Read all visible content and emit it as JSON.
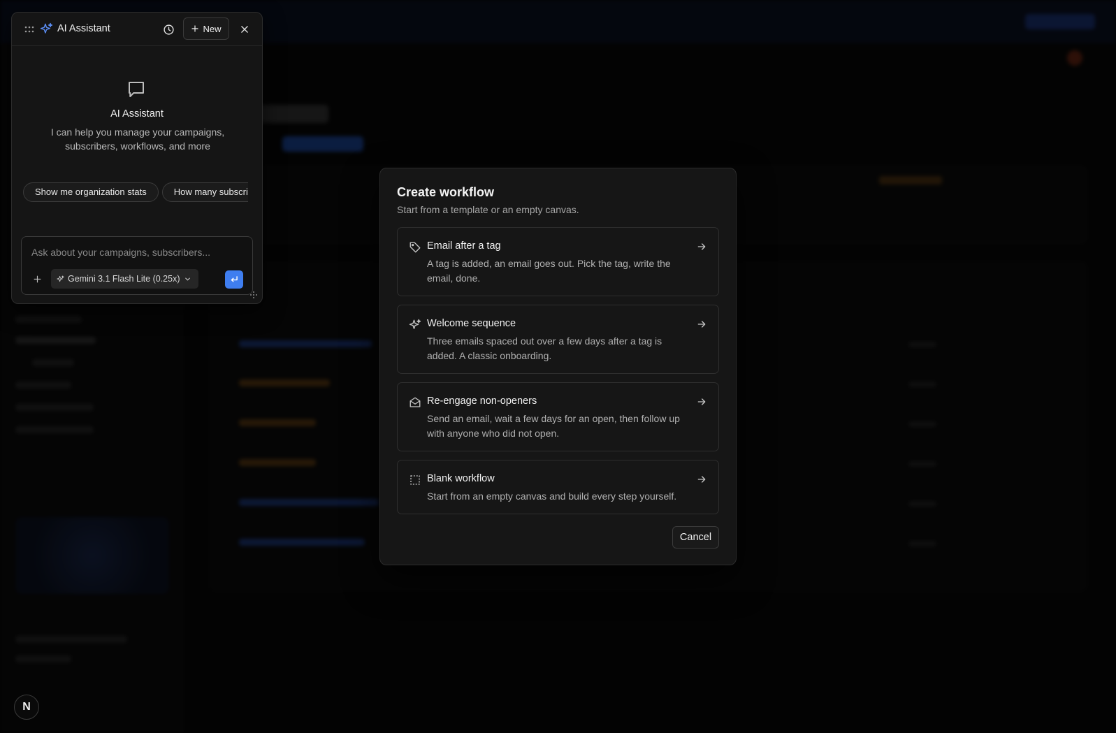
{
  "assistant": {
    "title": "AI Assistant",
    "new_label": "New",
    "empty_title": "AI Assistant",
    "empty_subtitle": "I can help you manage your campaigns, subscribers, workflows, and more",
    "suggestions": [
      "Show me organization stats",
      "How many subscribers"
    ],
    "input_placeholder": "Ask about your campaigns, subscribers...",
    "model_label": "Gemini 3.1 Flash Lite (0.25x)",
    "accent_color": "#3f7ef0"
  },
  "modal": {
    "title": "Create workflow",
    "subtitle": "Start from a template or an empty canvas.",
    "options": [
      {
        "icon": "tag-icon",
        "title": "Email after a tag",
        "description": "A tag is added, an email goes out. Pick the tag, write the email, done."
      },
      {
        "icon": "sparkle-icon",
        "title": "Welcome sequence",
        "description": "Three emails spaced out over a few days after a tag is added. A classic onboarding."
      },
      {
        "icon": "mail-open-icon",
        "title": "Re-engage non-openers",
        "description": "Send an email, wait a few days for an open, then follow up with anyone who did not open."
      },
      {
        "icon": "dashed-square-icon",
        "title": "Blank workflow",
        "description": "Start from an empty canvas and build every step yourself."
      }
    ],
    "cancel_label": "Cancel"
  },
  "app": {
    "logo_letter": "N"
  }
}
